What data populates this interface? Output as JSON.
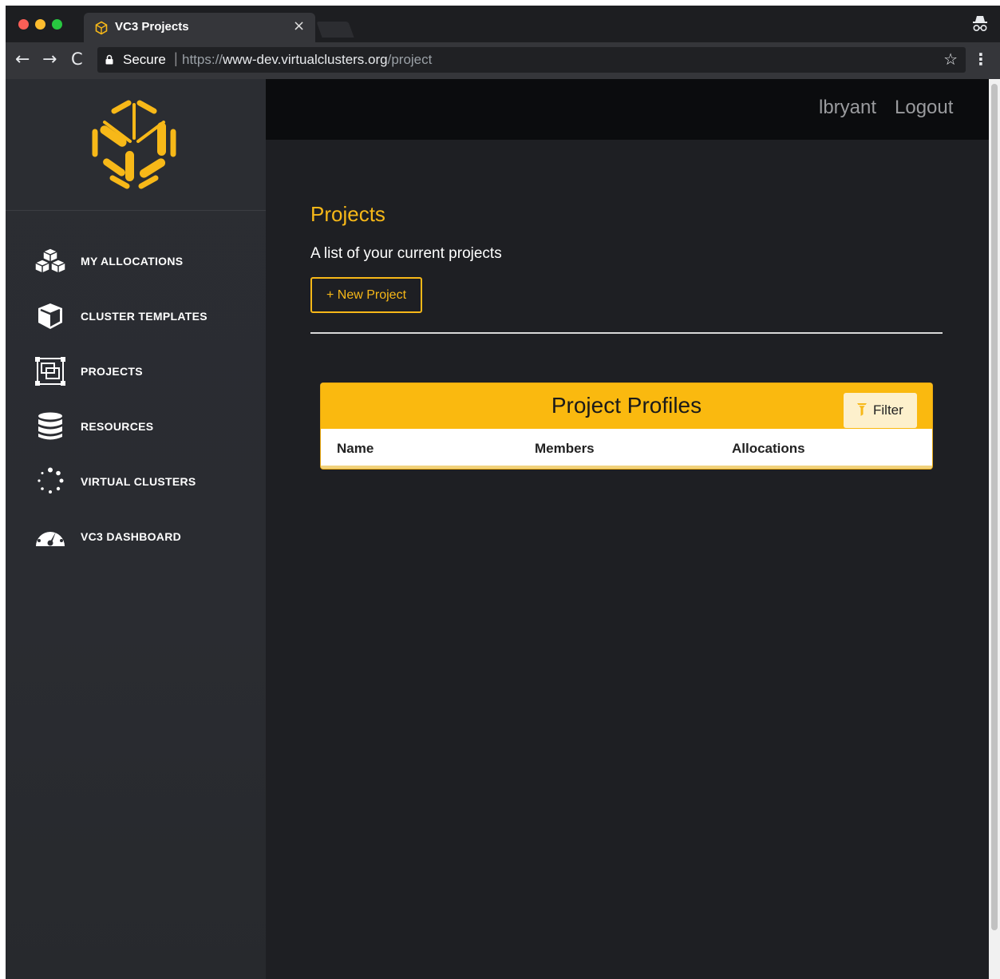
{
  "browser": {
    "tab_title": "VC3 Projects",
    "tab_close": "×",
    "security_label": "Secure",
    "separator": "|",
    "url_scheme": "https://",
    "url_host": "www-dev.virtualclusters.org",
    "url_path": "/project",
    "back_icon": "←",
    "forward_icon": "→",
    "reload_icon": "C",
    "bookmark_icon": "☆",
    "menu_icon": "⋮"
  },
  "header": {
    "username": "lbryant",
    "logout_label": "Logout"
  },
  "sidebar": {
    "items": [
      {
        "label": "MY ALLOCATIONS",
        "icon": "cubes-icon"
      },
      {
        "label": "CLUSTER TEMPLATES",
        "icon": "cube-icon"
      },
      {
        "label": "PROJECTS",
        "icon": "object-group-icon"
      },
      {
        "label": "RESOURCES",
        "icon": "database-icon"
      },
      {
        "label": "VIRTUAL CLUSTERS",
        "icon": "spinner-icon"
      },
      {
        "label": "VC3 DASHBOARD",
        "icon": "dashboard-icon"
      }
    ]
  },
  "main": {
    "title": "Projects",
    "subtitle": "A list of your current projects",
    "new_button_label": "+ New Project",
    "card": {
      "title": "Project Profiles",
      "filter_label": "Filter",
      "columns": [
        "Name",
        "Members",
        "Allocations"
      ]
    }
  },
  "colors": {
    "accent": "#f7b818",
    "card_header": "#fab90f",
    "sidebar_bg": "#2b2d32",
    "page_bg": "#1e1f23",
    "topbar_bg": "#0b0c0e"
  }
}
